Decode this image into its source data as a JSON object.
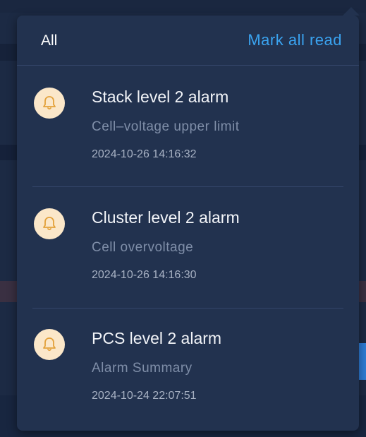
{
  "header": {
    "tab_label": "All",
    "mark_all_read_label": "Mark all read"
  },
  "notifications": [
    {
      "title": "Stack level 2 alarm",
      "description": "Cell–voltage upper limit",
      "time": "2024-10-26 14:16:32",
      "icon": "bell-icon"
    },
    {
      "title": "Cluster level 2 alarm",
      "description": "Cell overvoltage",
      "time": "2024-10-26 14:16:30",
      "icon": "bell-icon"
    },
    {
      "title": "PCS level 2 alarm",
      "description": "Alarm Summary",
      "time": "2024-10-24 22:07:51",
      "icon": "bell-icon"
    }
  ],
  "colors": {
    "panel_bg": "#22324f",
    "accent_link": "#3aa3f0",
    "icon_bg": "#fbe7c9",
    "icon_stroke": "#e3a13a"
  }
}
